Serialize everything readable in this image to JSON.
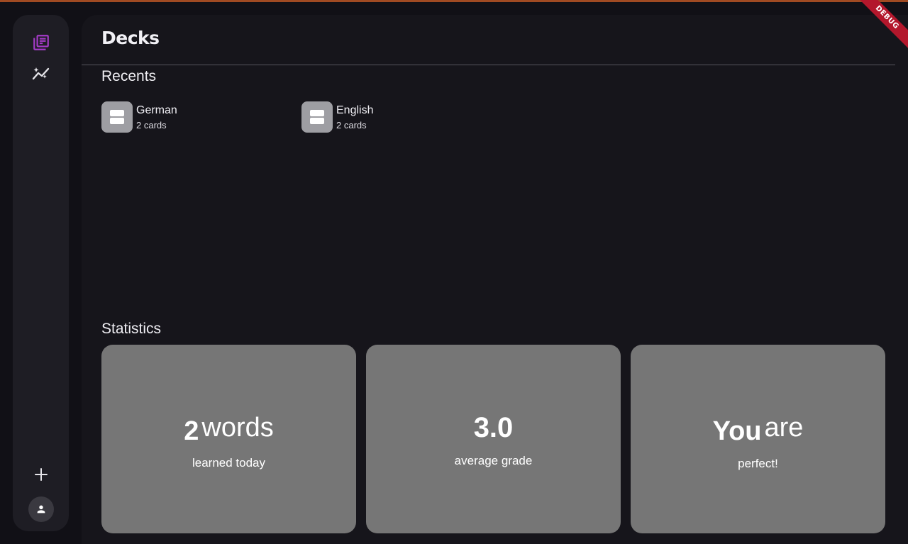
{
  "app": {
    "accent_color": "#a43bc7",
    "debug_banner": "DEBUG"
  },
  "sidebar": {
    "items": [
      {
        "icon": "library-books-icon",
        "active": true
      },
      {
        "icon": "auto-graph-icon",
        "active": false
      }
    ],
    "add_icon": "plus-icon",
    "profile_icon": "person-icon"
  },
  "page": {
    "title": "Decks"
  },
  "recents": {
    "title": "Recents",
    "decks": [
      {
        "name": "German",
        "count": "2 cards"
      },
      {
        "name": "English",
        "count": "2 cards"
      }
    ]
  },
  "statistics": {
    "title": "Statistics",
    "cards": [
      {
        "value": "2",
        "unit": "words",
        "label": "learned today"
      },
      {
        "value": "3.0",
        "label": "average grade"
      },
      {
        "value": "You",
        "unit": "are",
        "label": "perfect!"
      }
    ]
  }
}
